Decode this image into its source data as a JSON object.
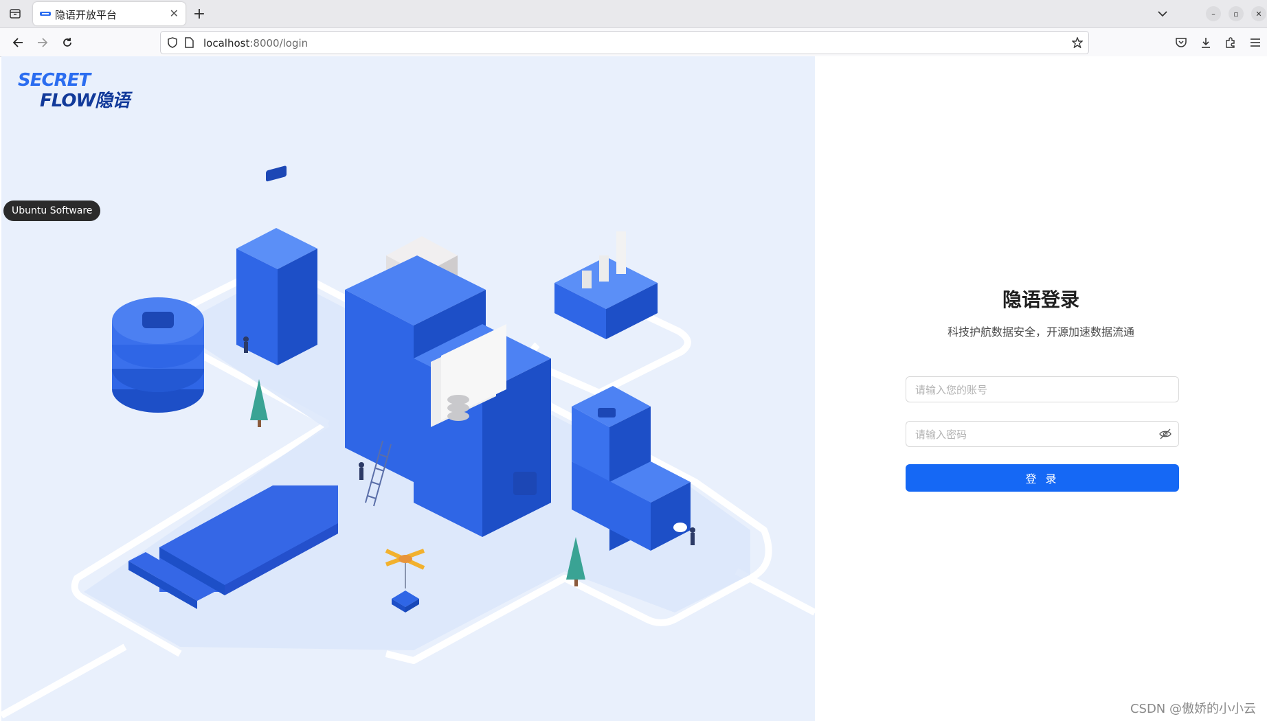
{
  "browser": {
    "tab_title": "隐语开放平台",
    "url_host": "localhost",
    "url_rest": ":8000/login"
  },
  "overlay": {
    "tooltip": "Ubuntu Software"
  },
  "brand": {
    "logo_line1": "SECRET",
    "logo_line2": "FLOW隐语",
    "primary_color": "#1568f5",
    "illustration_blue": "#2f66e6"
  },
  "login": {
    "title": "隐语登录",
    "subtitle": "科技护航数据安全，开源加速数据流通",
    "username_placeholder": "请输入您的账号",
    "password_placeholder": "请输入密码",
    "submit_label": "登 录"
  },
  "watermark": "CSDN @傲娇的小小云"
}
